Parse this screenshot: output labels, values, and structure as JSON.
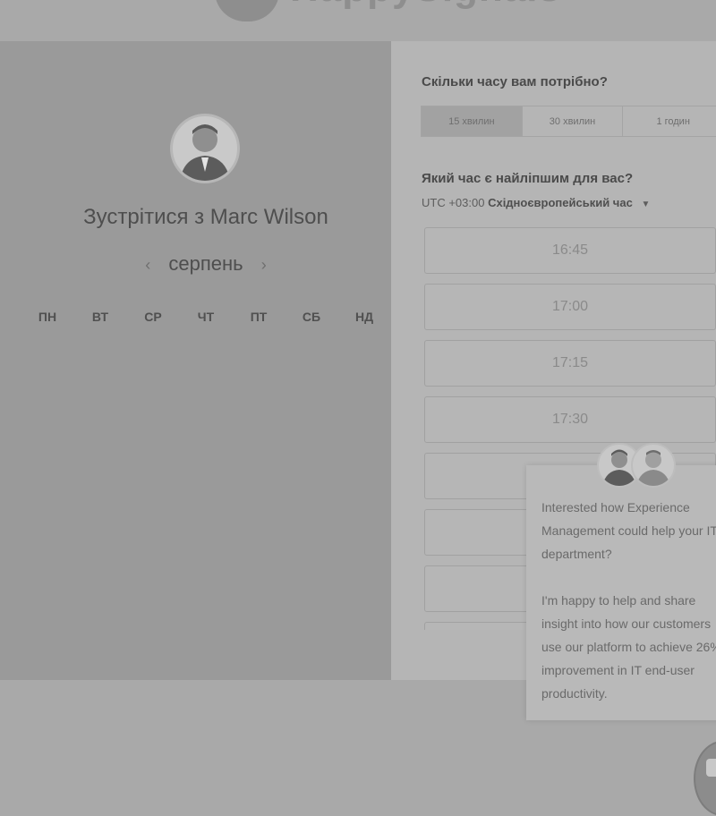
{
  "brand": {
    "name": "HappySignals"
  },
  "meeting": {
    "title": "Зустрітися з Marc Wilson",
    "month": "серпень",
    "weekdays": [
      "ПН",
      "ВТ",
      "СР",
      "ЧТ",
      "ПТ",
      "СБ",
      "НД"
    ]
  },
  "duration": {
    "question": "Скільки часу вам потрібно?",
    "options": [
      "15 хвилин",
      "30 хвилин",
      "1 годин"
    ],
    "selected": "15 хвилин"
  },
  "time": {
    "question": "Який час є найліпшим для вас?",
    "tz_offset": "UTC +03:00",
    "tz_name": "Східноєвропейський час",
    "slots": [
      "16:45",
      "17:00",
      "17:15",
      "17:30"
    ]
  },
  "chat": {
    "paragraph1": "Interested how Experience Management could help your IT department?",
    "paragraph2": "I'm happy to help and share insight into how our customers use our platform to achieve 26% improvement in IT end-user productivity."
  },
  "icons": {
    "prev": "chevron-left-icon",
    "next": "chevron-right-icon",
    "tz": "caret-down-icon",
    "launcher": "chat-icon"
  }
}
